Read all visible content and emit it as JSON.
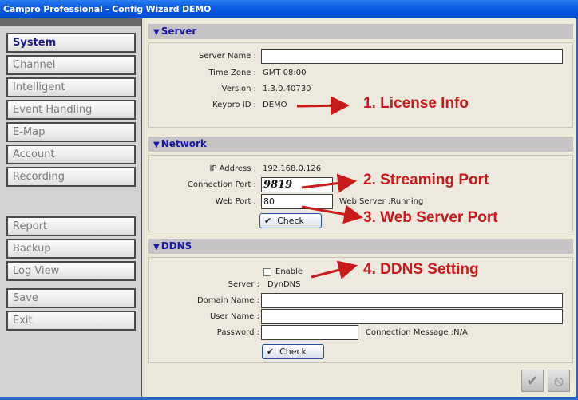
{
  "window": {
    "title": "Campro Professional - Config Wizard DEMO"
  },
  "sidebar": {
    "items": [
      {
        "label": "System",
        "active": true
      },
      {
        "label": "Channel"
      },
      {
        "label": "Intelligent"
      },
      {
        "label": "Event Handling"
      },
      {
        "label": "E-Map"
      },
      {
        "label": "Account"
      },
      {
        "label": "Recording"
      }
    ],
    "tools": [
      {
        "label": "Report"
      },
      {
        "label": "Backup"
      },
      {
        "label": "Log View"
      }
    ],
    "actions": [
      {
        "label": "Save"
      },
      {
        "label": "Exit"
      }
    ]
  },
  "server": {
    "title": "Server",
    "server_name_label": "Server Name :",
    "server_name_value": "",
    "time_zone_label": "Time Zone :",
    "time_zone_value": "GMT 08:00",
    "version_label": "Version :",
    "version_value": "1.3.0.40730",
    "keypro_label": "Keypro ID :",
    "keypro_value": "DEMO"
  },
  "network": {
    "title": "Network",
    "ip_label": "IP Address :",
    "ip_value": "192.168.0.126",
    "conn_port_label": "Connection Port :",
    "conn_port_value": "9819",
    "web_port_label": "Web Port :",
    "web_port_value": "80",
    "web_server_status": "Web Server :Running",
    "check_label": "Check"
  },
  "ddns": {
    "title": "DDNS",
    "enable_label": "Enable",
    "enabled": false,
    "server_label": "Server :",
    "server_value": "DynDNS",
    "domain_label": "Domain Name :",
    "domain_value": "",
    "user_label": "User Name :",
    "user_value": "",
    "password_label": "Password :",
    "password_value": "",
    "conn_msg": "Connection Message :N/A",
    "check_label": "Check"
  },
  "annotations": {
    "a1": "1. License Info",
    "a2": "2. Streaming Port",
    "a3": "3. Web Server Port",
    "a4": "4. DDNS Setting",
    "color": "#c81a1a"
  },
  "footer": {
    "ok_icon": "checkmark-icon",
    "cancel_icon": "cancel-icon"
  }
}
